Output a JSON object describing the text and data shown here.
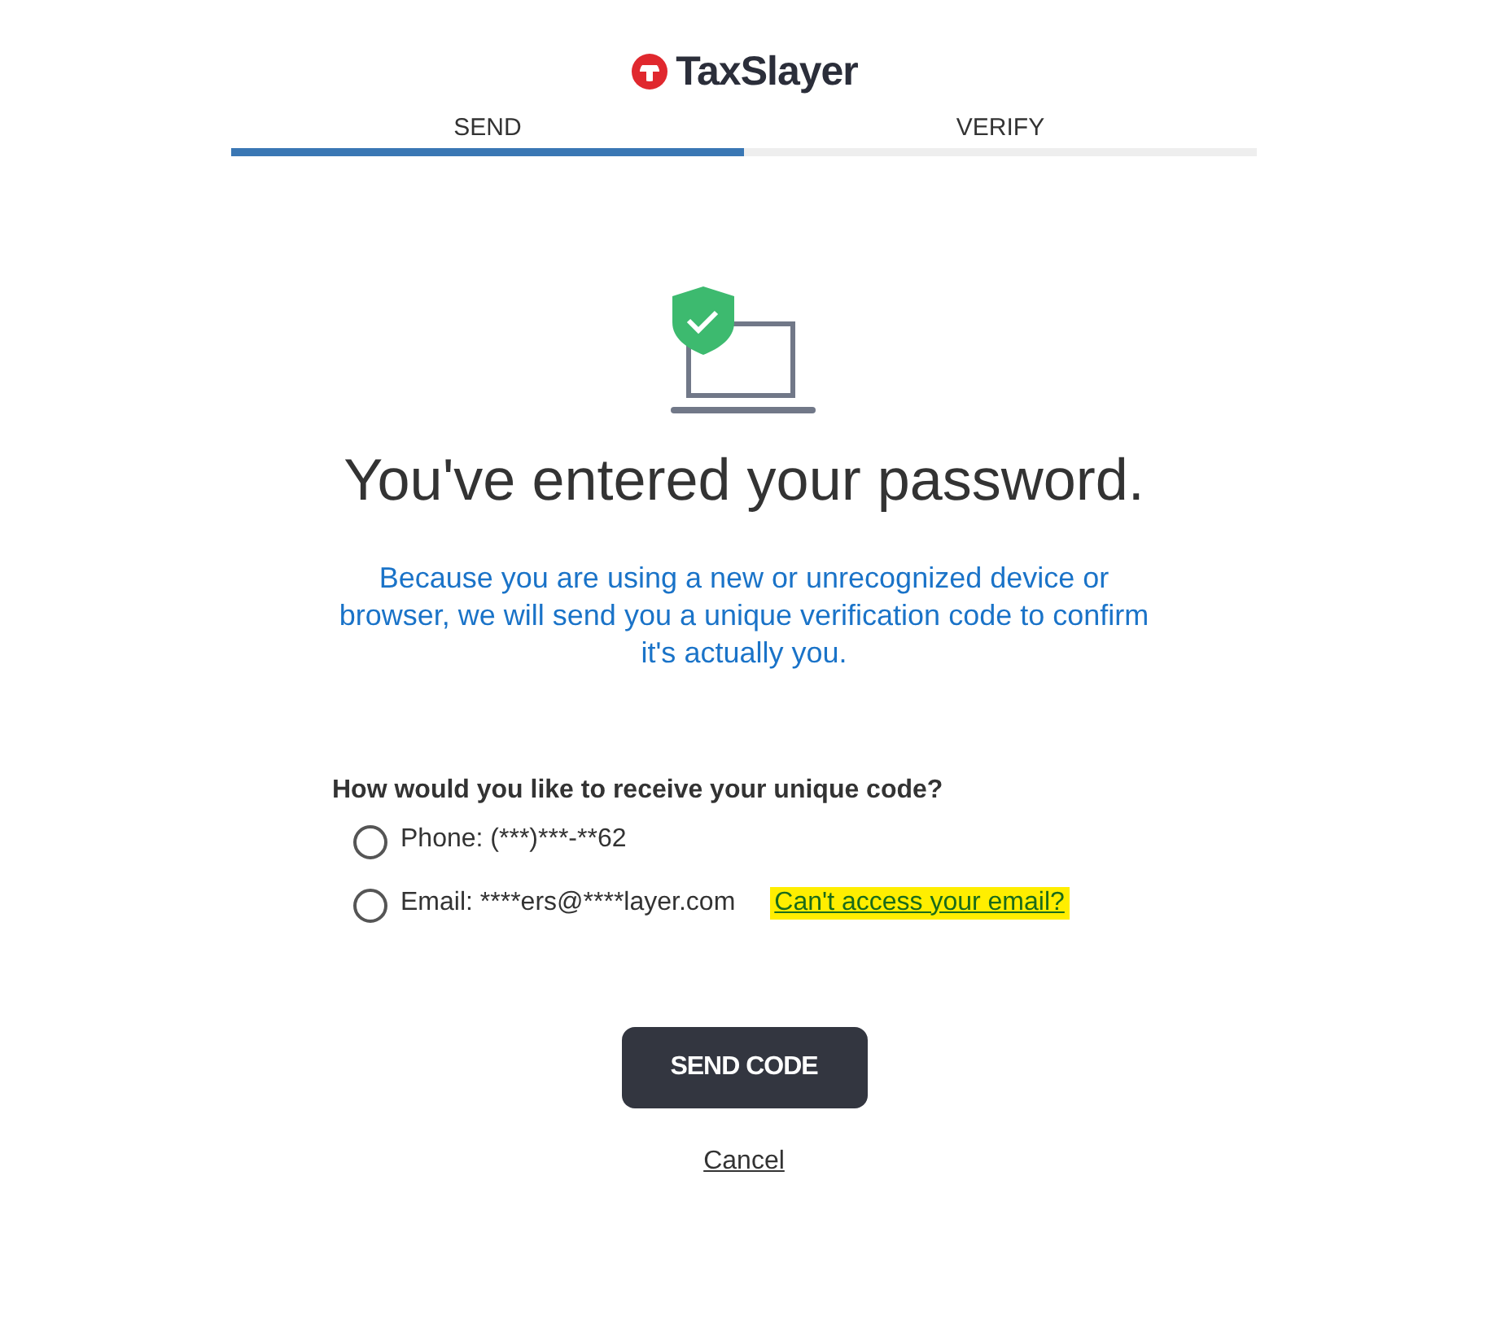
{
  "logo": {
    "text": "TaxSlayer"
  },
  "steps": [
    {
      "label": "SEND",
      "selected": true
    },
    {
      "label": "VERIFY",
      "selected": false
    }
  ],
  "heading": "You've entered your password.",
  "message": "Because you are using a new or unrecognized device or browser, we will send you a unique verification code to confirm it's actually you.",
  "question": "How would you like to receive your unique code?",
  "options": [
    {
      "label": "Phone: (***)***-**62",
      "selected": false
    },
    {
      "label": "Email: ****ers@****layer.com",
      "selected": false,
      "link": {
        "text": "Can't access your email?",
        "highlighted": true
      }
    }
  ],
  "primary_button": "SEND CODE",
  "cancel_link": "Cancel"
}
